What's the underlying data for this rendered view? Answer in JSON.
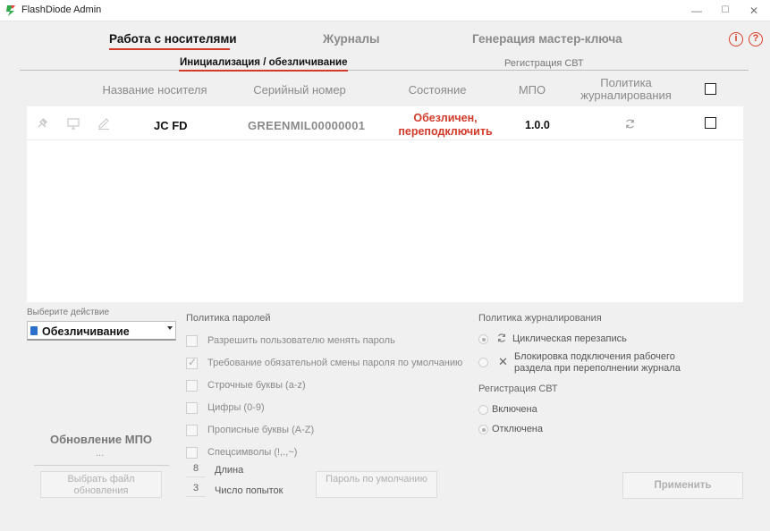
{
  "window": {
    "title": "FlashDiode Admin",
    "minimize": "—",
    "maximize": "☐",
    "close": "✕"
  },
  "main_tabs": [
    {
      "label": "Работа с носителями",
      "active": true
    },
    {
      "label": "Журналы",
      "active": false
    },
    {
      "label": "Генерация мастер-ключа",
      "active": false
    }
  ],
  "sub_tabs": [
    {
      "label": "Инициализация / обезличивание",
      "active": true
    },
    {
      "label": "Регистрация СВТ",
      "active": false
    }
  ],
  "help_icons": [
    "i",
    "?"
  ],
  "table": {
    "headers": {
      "name": "Название носителя",
      "serial": "Серийный номер",
      "state": "Состояние",
      "mpo": "МПО",
      "policy": "Политика журналирования"
    },
    "rows": [
      {
        "name": "JC FD",
        "serial": "GREENMIL00000001",
        "state": "Обезличен, переподключить",
        "mpo": "1.0.0"
      }
    ]
  },
  "action": {
    "label": "Выберите действие",
    "selected": "Обезличивание"
  },
  "password_policy": {
    "title": "Политика паролей",
    "options": [
      {
        "label": "Разрешить пользователю менять пароль",
        "checked": false
      },
      {
        "label": "Требование обязательной смены пароля по умолчанию",
        "checked": true
      },
      {
        "label": "Строчные буквы (a-z)",
        "checked": false
      },
      {
        "label": "Цифры (0-9)",
        "checked": false
      },
      {
        "label": "Прописные буквы (A-Z)",
        "checked": false
      },
      {
        "label": "Спецсимволы (!,.,~)",
        "checked": false
      }
    ],
    "length_value": "8",
    "length_label": "Длина",
    "attempts_value": "3",
    "attempts_label": "Число попыток",
    "default_password_button": "Пароль по умолчанию"
  },
  "log_policy": {
    "title": "Политика журналирования",
    "options": [
      {
        "label": "Циклическая перезапись",
        "selected": true
      },
      {
        "label": "Блокировка подключения рабочего раздела при переполнении журнала",
        "selected": false
      }
    ]
  },
  "svt_registration": {
    "title": "Регистрация СВТ",
    "options": [
      {
        "label": "Включена",
        "selected": false
      },
      {
        "label": "Отключена",
        "selected": true
      }
    ]
  },
  "mpo_update": {
    "title": "Обновление МПО",
    "value": "...",
    "select_button": "Выбрать файл обновления"
  },
  "apply_button": "Применить",
  "colors": {
    "accent": "#d23b2a",
    "state_text": "#d23b2a"
  }
}
